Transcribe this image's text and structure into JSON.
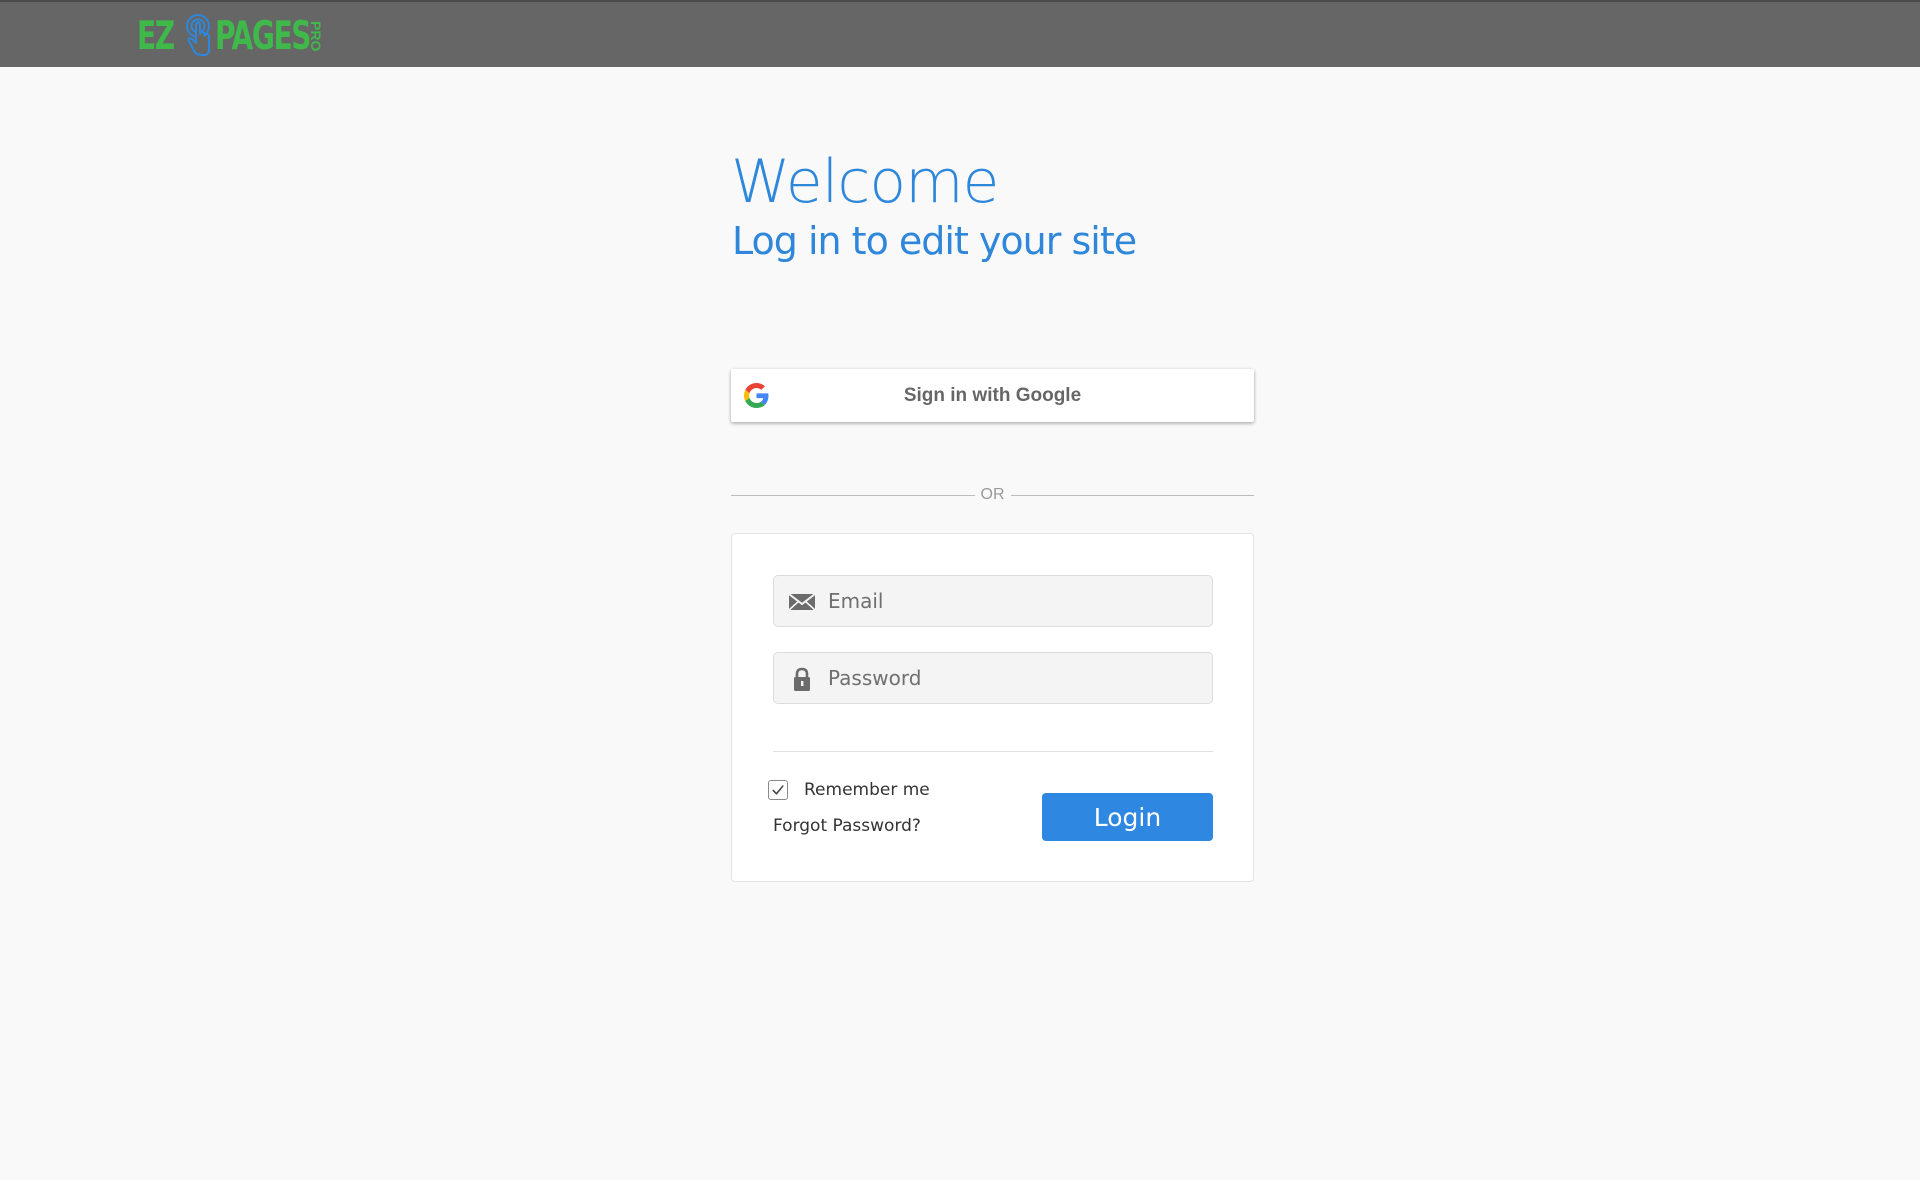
{
  "header": {
    "logo": {
      "left_text": "EZ",
      "right_text": "PAGES",
      "suffix": "PRO",
      "icon": "pointing-hand-icon",
      "color": "#3fb94a"
    },
    "background_color": "#666666"
  },
  "main": {
    "welcome_title": "Welcome",
    "subtitle": "Log in to edit your site",
    "accent_color": "#2e87da"
  },
  "google_signin": {
    "label": "Sign in with Google",
    "icon": "google-g-icon"
  },
  "separator": {
    "label": "OR"
  },
  "login_form": {
    "email": {
      "placeholder": "Email",
      "value": "",
      "icon": "envelope-icon"
    },
    "password": {
      "placeholder": "Password",
      "value": "",
      "icon": "lock-icon"
    },
    "remember_me": {
      "label": "Remember me",
      "checked": true
    },
    "forgot_password_label": "Forgot Password?",
    "login_button_label": "Login",
    "button_color": "#2e87e0"
  }
}
